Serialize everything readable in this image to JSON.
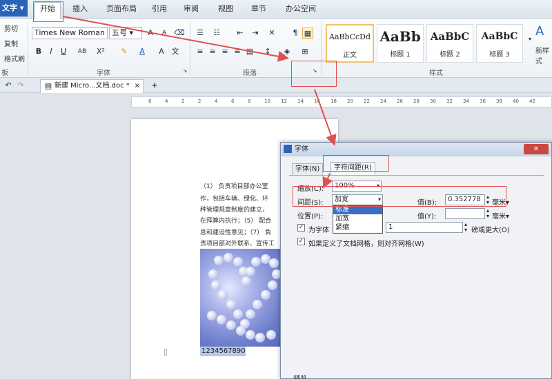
{
  "menubar": {
    "app_button": "文字",
    "tabs": [
      "开始",
      "插入",
      "页面布局",
      "引用",
      "审阅",
      "视图",
      "章节",
      "办公空间"
    ],
    "active_tab": "开始"
  },
  "ribbon": {
    "clipboard": {
      "cut": "剪切",
      "copy": "复制",
      "format_painter": "格式刷",
      "group": "板"
    },
    "font": {
      "name": "Times New Roman",
      "size": "五号",
      "group": "字体"
    },
    "paragraph": {
      "group": "段落"
    },
    "styles": {
      "group": "样式",
      "tiles": [
        {
          "sample": "AaBbCcDd",
          "name": "正文"
        },
        {
          "sample": "AaBb",
          "name": "标题 1"
        },
        {
          "sample": "AaBbC",
          "name": "标题 2"
        },
        {
          "sample": "AaBbC",
          "name": "标题 3"
        }
      ],
      "new_style": "新样式"
    }
  },
  "tabbar": {
    "doc_tab": "新建 Micro...文档.doc *"
  },
  "ruler": {
    "ticks": [
      "6",
      "4",
      "2",
      "2",
      "4",
      "6",
      "8",
      "10",
      "12",
      "14",
      "16",
      "18",
      "20",
      "22",
      "24",
      "26",
      "28",
      "30",
      "32",
      "34",
      "36",
      "38",
      "40",
      "42"
    ]
  },
  "document": {
    "lines": [
      "（1） 负责项目部办公室",
      "作，包括车辆、绿化、环",
      "种管理规章制度的建立，",
      "在拜算内执行；（5） 配合",
      "息和建设性意见；（7） 負",
      "责项目部对外联系、宣传工"
    ],
    "selected_text": "1234567890"
  },
  "dialog": {
    "title": "字体",
    "tabs": [
      "字体(N)",
      "字符间距(R)"
    ],
    "active_tab": "字符间距(R)",
    "scale_label": "缩放(C):",
    "scale_value": "100%",
    "spacing_label": "间距(S):",
    "spacing_value": "加宽",
    "spacing_options": [
      "标准",
      "加宽",
      "紧缩"
    ],
    "spacing_highlighted": "标准",
    "value_label": "值(B):",
    "value_value": "0.352778",
    "value_unit": "毫米",
    "position_label": "位置(P):",
    "position_value_label": "值(Y):",
    "position_unit": "毫米",
    "kerning_label": "为字体",
    "kerning_value": "1",
    "kerning_suffix": "磅或更大(O)",
    "grid_label": "如果定义了文档网格，则对齐网格(W)",
    "preview_label": "预览"
  }
}
